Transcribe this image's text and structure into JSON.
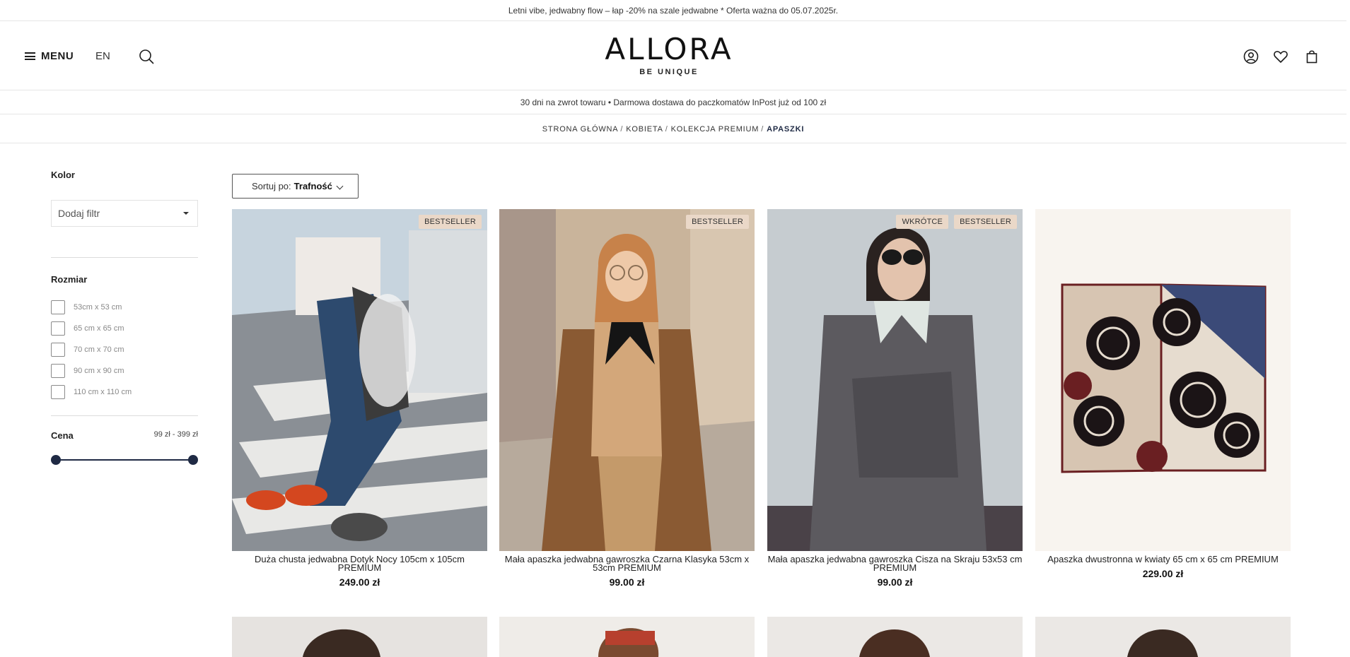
{
  "promo": {
    "text": "Letni vibe, jedwabny flow – łap -20% na szale jedwabne * Oferta ważna do 05.07.2025r."
  },
  "header": {
    "menu_label": "MENU",
    "language": "EN",
    "logo": "ALLORA",
    "tagline": "BE UNIQUE",
    "icons": [
      "search-icon",
      "account-icon",
      "heart-icon",
      "bag-icon"
    ]
  },
  "info": {
    "text": "30 dni na zwrot towaru • Darmowa dostawa do paczkomatów InPost już od 100 zł"
  },
  "breadcrumb": {
    "items": [
      "STRONA GŁÓWNA",
      "KOBIETA",
      "KOLEKCJA PREMIUM",
      "APASZKI"
    ],
    "separator": "/"
  },
  "filters": {
    "color": {
      "title": "Kolor",
      "dropdown_label": "Dodaj filtr"
    },
    "size": {
      "title": "Rozmiar",
      "options": [
        "53cm x 53 cm",
        "65 cm x 65 cm",
        "70 cm x 70 cm",
        "90 cm x 90 cm",
        "110 cm x 110 cm"
      ]
    },
    "price": {
      "title": "Cena",
      "range": "99 zł - 399 zł",
      "min_fraction": 0,
      "max_fraction": 1
    }
  },
  "sort": {
    "label": "Sortuj po:",
    "value": "Trafność"
  },
  "products": [
    {
      "name": "Duża chusta jedwabna Dotyk Nocy 105cm x 105cm PREMIUM",
      "price": "249.00 zł",
      "badges": [
        "BESTSELLER"
      ]
    },
    {
      "name": "Mała apaszka jedwabna gawroszka Czarna Klasyka 53cm x 53cm PREMIUM",
      "price": "99.00 zł",
      "badges": [
        "BESTSELLER"
      ]
    },
    {
      "name": "Mała apaszka jedwabna gawroszka Cisza na Skraju 53x53 cm PREMIUM",
      "price": "99.00 zł",
      "badges": [
        "WKRÓTCE",
        "BESTSELLER"
      ]
    },
    {
      "name": "Apaszka dwustronna w kwiaty 65 cm x 65 cm PREMIUM",
      "price": "229.00 zł",
      "badges": []
    }
  ],
  "colors": {
    "navy": "#1f2a44",
    "badge_bg": "#ead8c8",
    "border": "#e6e6e6"
  }
}
